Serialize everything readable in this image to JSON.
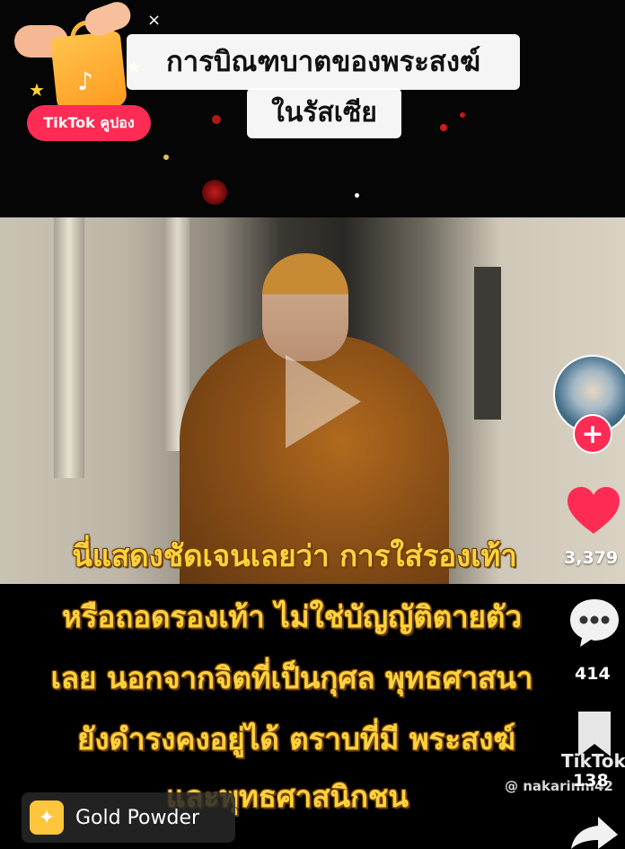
{
  "coupon": {
    "label": "TikTok คูปอง",
    "close_glyph": "×",
    "logo_glyph": "♪",
    "star_glyph": "★"
  },
  "video": {
    "title_line1": "การบิณฑบาตของพระสงฆ์",
    "title_line2": "ในรัสเซีย",
    "caption_lines": [
      "นี่แสดงชัดเจนเลยว่า การใส่รองเท้า",
      "หรือถอดรองเท้า ไม่ใช่บัญญัติตายตัว",
      "เลย นอกจากจิตที่เป็นกุศล พุทธศาสนา",
      "ยังดำรงคงอยู่ได้ ตราบที่มี พระสงฆ์",
      "และพุทธศาสนิกชน"
    ],
    "watermark_user": "@ nakarinm42",
    "watermark_brand": "TikTok"
  },
  "actions": {
    "follow_glyph": "+",
    "likes": "3,379",
    "comments": "414",
    "saves": "138"
  },
  "bottom_chip": {
    "label": "Gold Powder",
    "icon_glyph": "✦"
  },
  "colors": {
    "like_red": "#fe2c55",
    "caption_yellow": "#ffd23d",
    "gold": "#ffc53d"
  }
}
